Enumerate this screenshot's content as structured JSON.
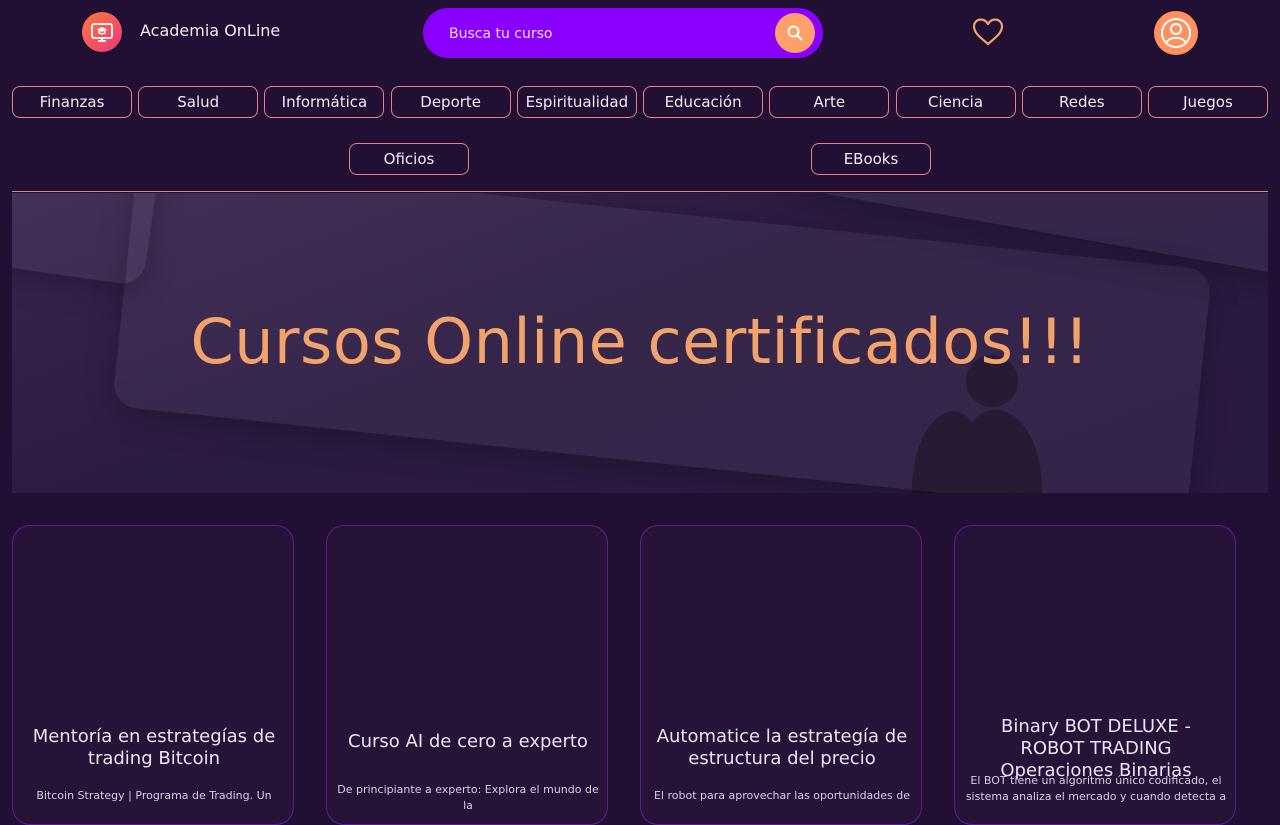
{
  "header": {
    "brand": "Academia OnLine",
    "search_placeholder": "Busca tu curso"
  },
  "categories": [
    "Finanzas",
    "Salud",
    "Informática",
    "Deporte",
    "Espiritualidad",
    "Educación",
    "Arte",
    "Ciencia",
    "Redes",
    "Juegos"
  ],
  "categories_row2": [
    "Oficios",
    "EBooks"
  ],
  "hero": {
    "title": "Cursos Online certificados!!!"
  },
  "courses": [
    {
      "title": "Mentoría en estrategías de trading Bitcoin",
      "description": "Bitcoin Strategy | Programa de Trading. Un"
    },
    {
      "title": "Curso AI de cero a experto",
      "description": "De principiante a experto: Explora el mundo de la"
    },
    {
      "title": "Automatice la estrategía de estructura del precio",
      "description": "El robot para aprovechar las oportunidades de"
    },
    {
      "title": "Binary BOT DELUXE - ROBOT TRADING Operaciones Binarias",
      "description": "El BOT tiene un algoritmo único codificado, el sistema analiza el mercado y cuando detecta a"
    }
  ],
  "colors": {
    "background": "#211033",
    "search": "#8a00ff",
    "accent": "#ff9f6a",
    "hero_text": "#f2a36b",
    "button_border": "#f07a86"
  }
}
